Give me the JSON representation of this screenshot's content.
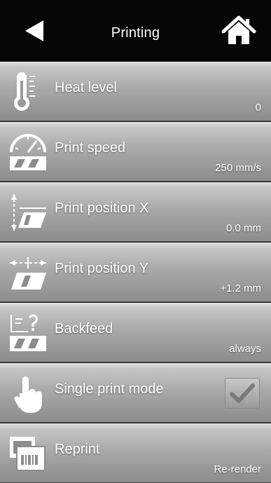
{
  "header": {
    "title": "Printing",
    "back_icon": "back-arrow-icon",
    "home_icon": "home-icon"
  },
  "menu": {
    "items": [
      {
        "label": "Heat level",
        "value": "0",
        "icon": "thermometer-icon"
      },
      {
        "label": "Print speed",
        "value": "250 mm/s",
        "icon": "speedometer-icon"
      },
      {
        "label": "Print position X",
        "value": "0.0 mm",
        "icon": "position-x-icon"
      },
      {
        "label": "Print position Y",
        "value": "+1.2 mm",
        "icon": "position-y-icon"
      },
      {
        "label": "Backfeed",
        "value": "always",
        "icon": "backfeed-icon"
      },
      {
        "label": "Single print mode",
        "checked": true,
        "icon": "hand-pointer-icon"
      },
      {
        "label": "Reprint",
        "value": "Re-render",
        "icon": "reprint-icon"
      }
    ]
  },
  "colors": {
    "header_bg": "#050505",
    "row_light": "#dcdcdc",
    "row_dark": "#8c8c8c",
    "text": "#ffffff"
  }
}
